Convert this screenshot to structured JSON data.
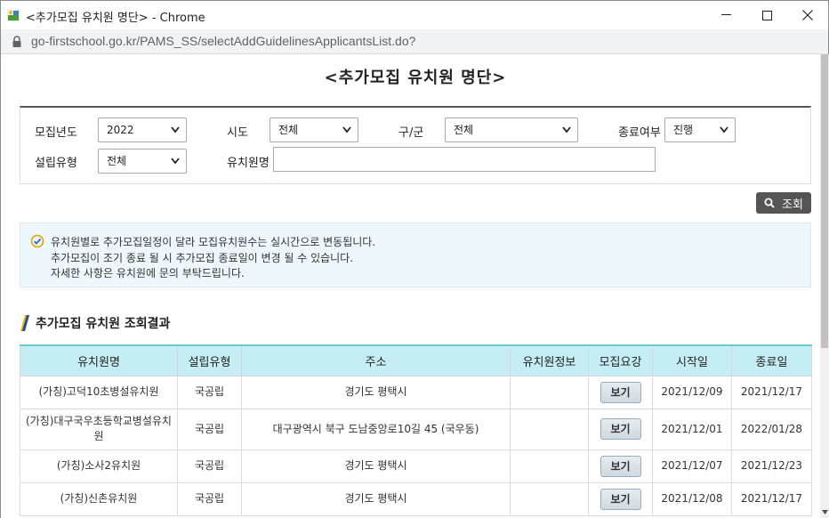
{
  "window": {
    "title": "<추가모집 유치원 명단> - Chrome",
    "url": "go-firstschool.go.kr/PAMS_SS/selectAddGuidelinesApplicantsList.do?"
  },
  "page": {
    "title": "<추가모집 유치원 명단>"
  },
  "search": {
    "year_label": "모집년도",
    "year_value": "2022",
    "sido_label": "시도",
    "sido_value": "전체",
    "gugun_label": "구/군",
    "gugun_value": "전체",
    "end_label": "종료여부",
    "end_value": "진행",
    "type_label": "설립유형",
    "type_value": "전체",
    "name_label": "유치원명",
    "name_value": "",
    "button_label": "조회"
  },
  "notice": {
    "lines": [
      "유치원별로 추가모집일정이 달라 모집유치원수는 실시간으로 변동됩니다.",
      "추가모집이 조기 종료 될 시 추가모집 종료일이 변경 될 수 있습니다.",
      "자세한 사항은 유치원에 문의 부탁드립니다."
    ]
  },
  "results": {
    "title": "추가모집 유치원 조회결과",
    "columns": [
      "유치원명",
      "설립유형",
      "주소",
      "유치원정보",
      "모집요강",
      "시작일",
      "종료일"
    ],
    "view_label": "보기",
    "rows": [
      {
        "name": "(가칭)고덕10초병설유치원",
        "type": "국공립",
        "address": "경기도 평택시",
        "info": "",
        "start": "2021/12/09",
        "end": "2021/12/17"
      },
      {
        "name": "(가칭)대구국우초등학교병설유치원",
        "type": "국공립",
        "address": "대구광역시 북구 도남중앙로10길 45 (국우동)",
        "info": "",
        "start": "2021/12/01",
        "end": "2022/01/28"
      },
      {
        "name": "(가칭)소사2유치원",
        "type": "국공립",
        "address": "경기도 평택시",
        "info": "",
        "start": "2021/12/07",
        "end": "2021/12/23"
      },
      {
        "name": "(가칭)신촌유치원",
        "type": "국공립",
        "address": "경기도 평택시",
        "info": "",
        "start": "2021/12/08",
        "end": "2021/12/17"
      }
    ]
  }
}
